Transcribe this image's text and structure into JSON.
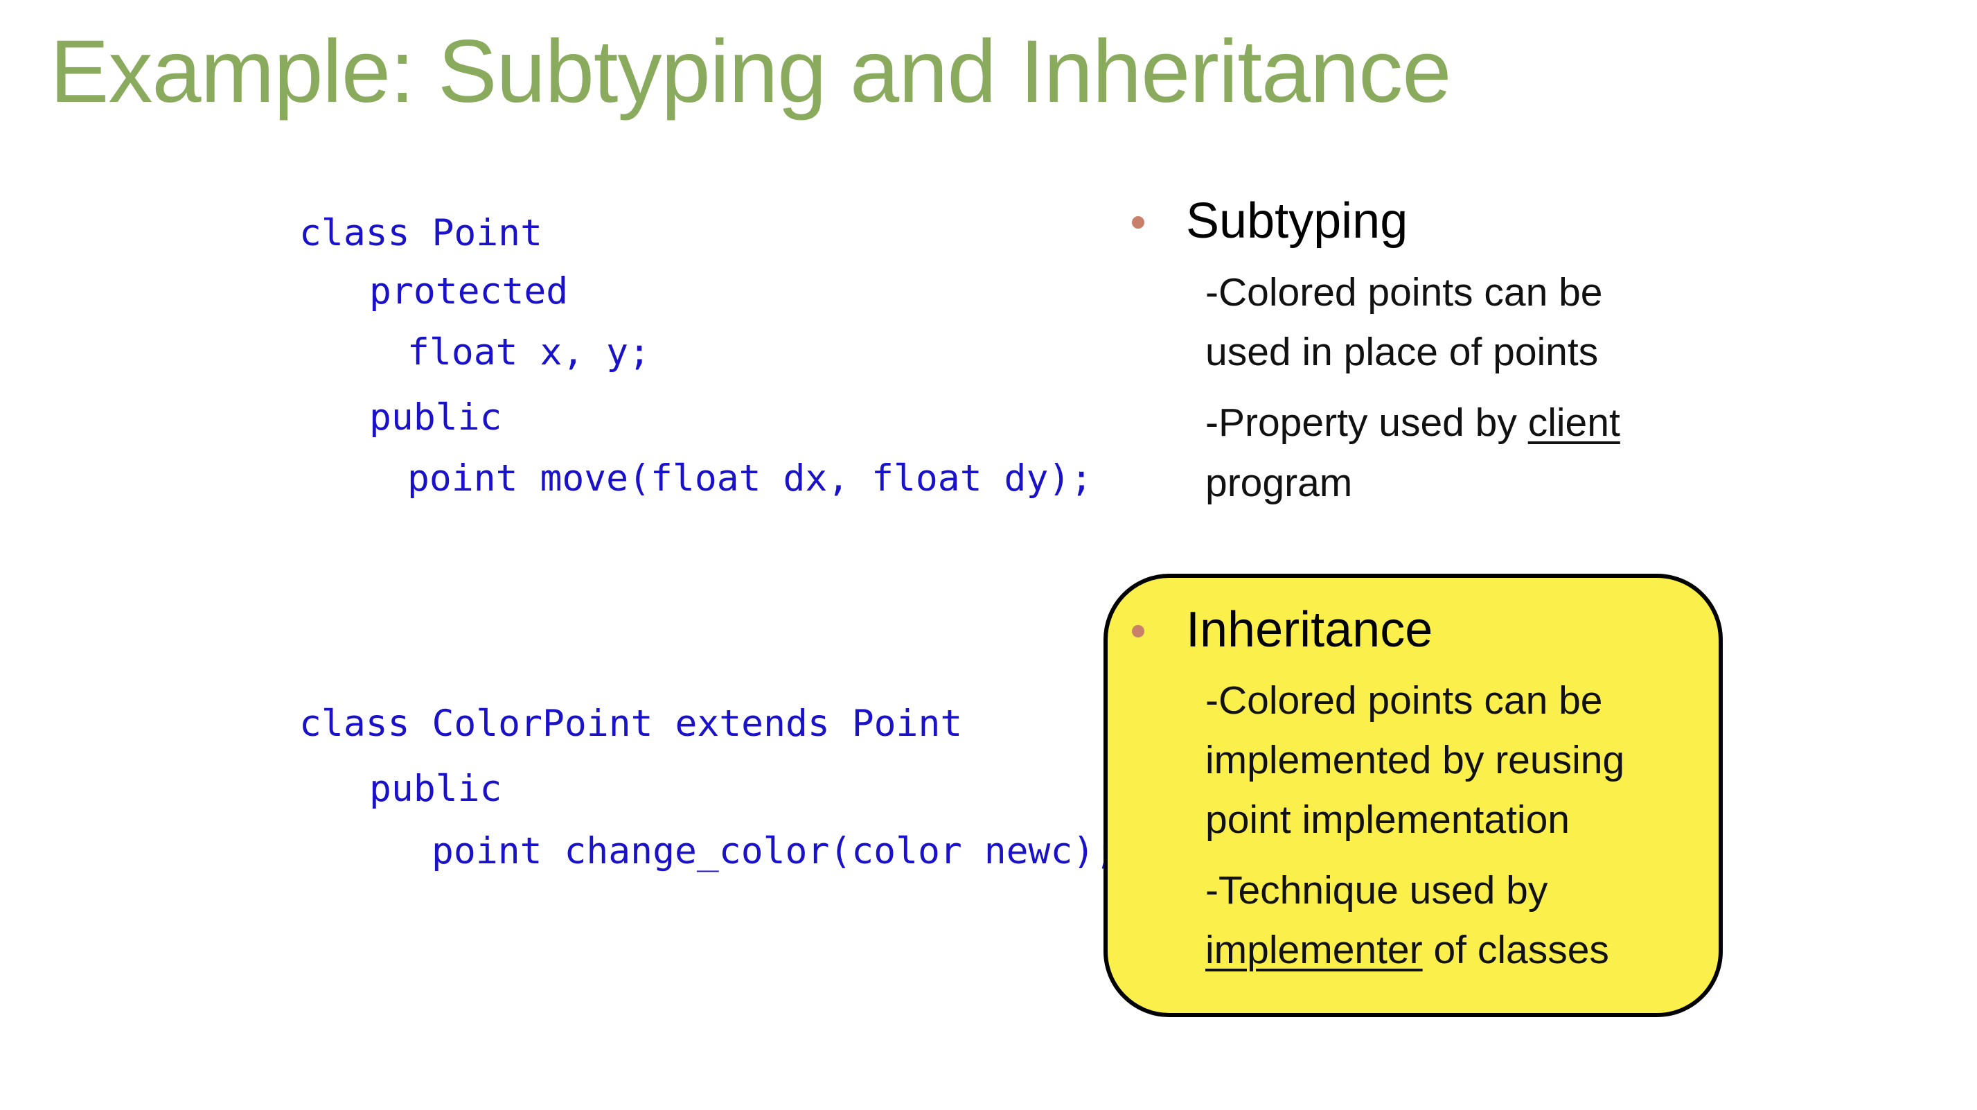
{
  "slide": {
    "title": "Example: Subtyping and Inheritance",
    "code": {
      "point_class": [
        "class Point",
        "protected",
        "float x, y;",
        "public",
        "point move(float dx, float dy);"
      ],
      "colorpoint_class": [
        "class ColorPoint extends Point",
        "public",
        "point change_color(color newc);"
      ]
    },
    "subtyping": {
      "heading": "Subtyping",
      "item1_line1": "-Colored points can be",
      "item1_line2": "used in place of points",
      "item2_prefix": "-Property used by ",
      "item2_underlined": "client",
      "item2_line2": "program"
    },
    "inheritance": {
      "heading": "Inheritance",
      "item1_line1": "-Colored points can be",
      "item1_line2": "implemented by reusing",
      "item1_line3": "point implementation",
      "item2_line1": "-Technique used by",
      "item2_underlined": "implementer",
      "item2_suffix": " of classes"
    },
    "colors": {
      "title": "#8aab5e",
      "code": "#1a12c8",
      "bullet": "#c8806a",
      "highlight": "#fbef4b"
    }
  }
}
